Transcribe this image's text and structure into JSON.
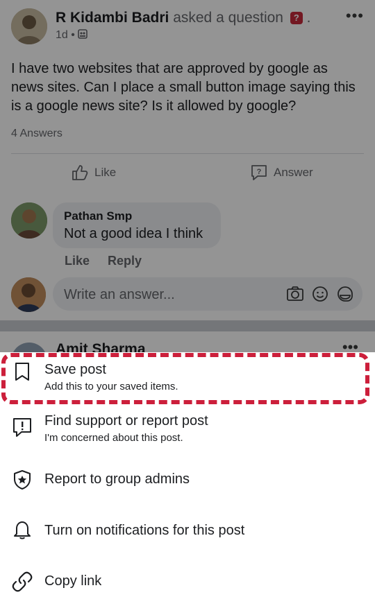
{
  "post": {
    "author": "R Kidambi Badri",
    "action_text": " asked a question",
    "badge": "?",
    "trailing_dot": ".",
    "time": "1d",
    "dot": "•",
    "more": "•••",
    "text": "I have two websites that are approved by google as news sites. Can I place a small button image saying this is a google news site? Is it allowed by google?",
    "answers_count": "4 Answers",
    "like_label": "Like",
    "answer_label": "Answer"
  },
  "comment": {
    "author": "Pathan Smp",
    "text": "Not a good idea I think",
    "like_label": "Like",
    "reply_label": "Reply"
  },
  "composer": {
    "placeholder": "Write an answer..."
  },
  "next_post": {
    "author": "Amit Sharma",
    "more": "•••"
  },
  "menu": {
    "items": [
      {
        "title": "Save post",
        "subtitle": "Add this to your saved items.",
        "icon": "bookmark-icon"
      },
      {
        "title": "Find support or report post",
        "subtitle": "I'm concerned about this post.",
        "icon": "report-icon"
      },
      {
        "title": "Report to group admins",
        "subtitle": "",
        "icon": "shield-star-icon"
      },
      {
        "title": "Turn on notifications for this post",
        "subtitle": "",
        "icon": "bell-icon"
      },
      {
        "title": "Copy link",
        "subtitle": "",
        "icon": "link-icon"
      }
    ]
  },
  "colors": {
    "highlight": "#cc1f3b",
    "question_badge": "#c62a3b"
  }
}
